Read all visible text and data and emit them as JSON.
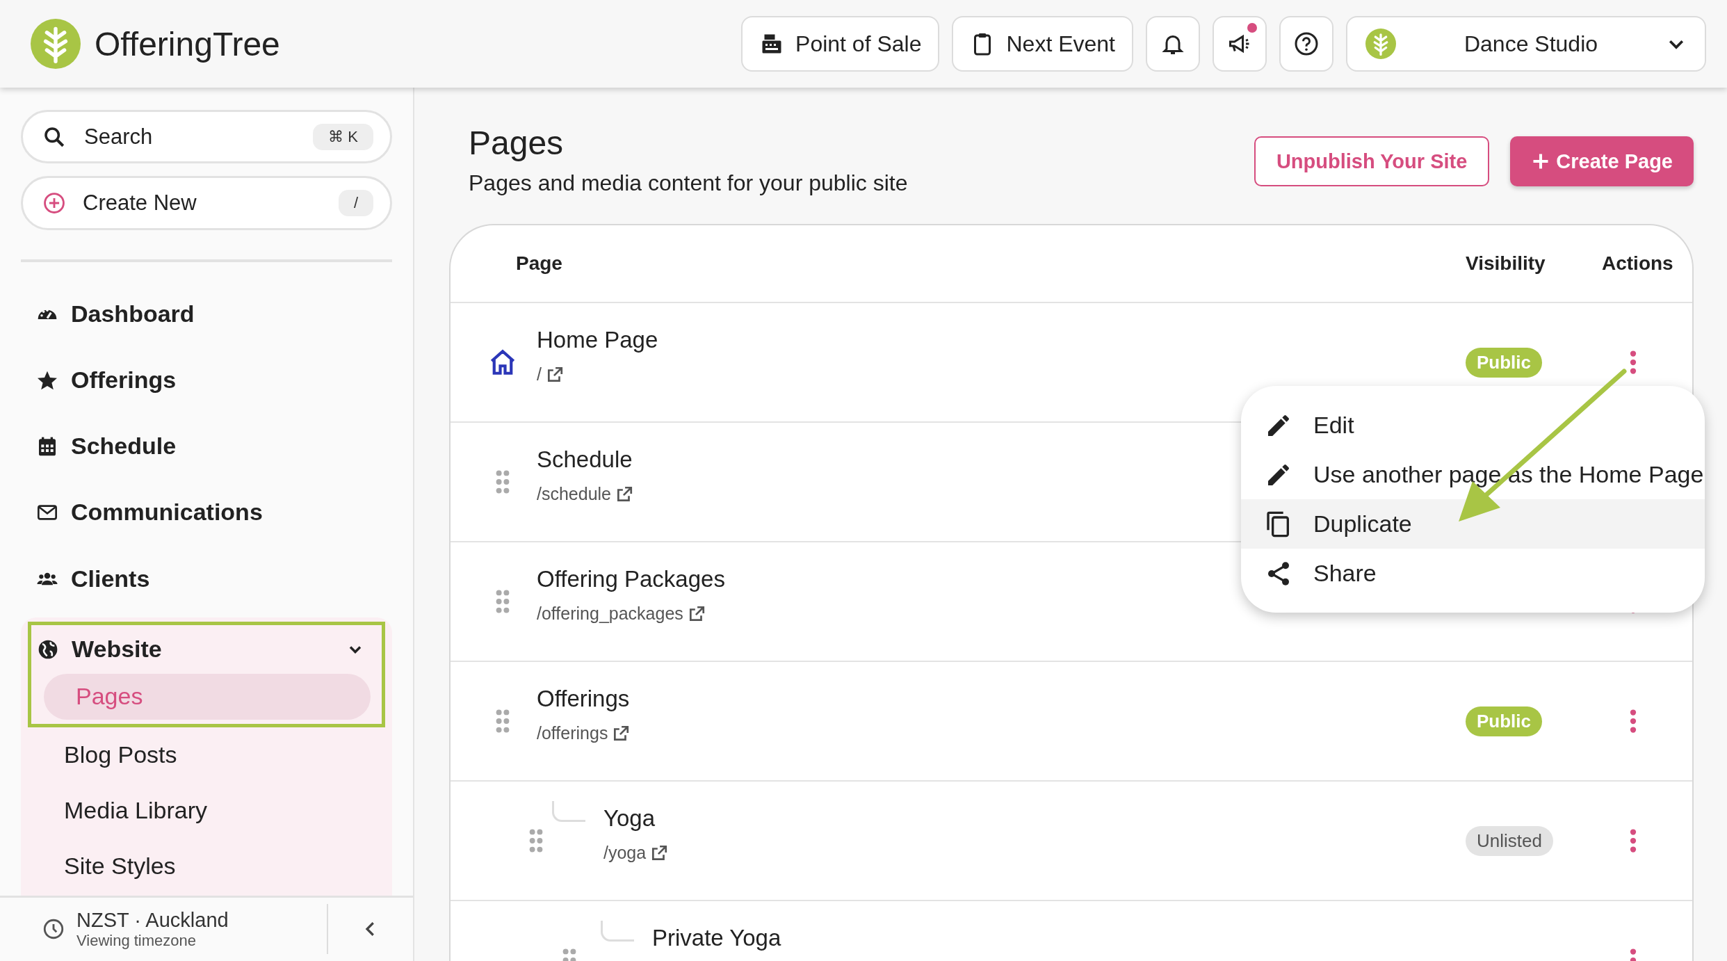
{
  "header": {
    "logo": "OfferingTree",
    "buttons": [
      {
        "kind": "register",
        "label": "Point of Sale"
      },
      {
        "kind": "clipboard",
        "label": "Next Event"
      },
      {
        "kind": "bell"
      },
      {
        "kind": "megaphone",
        "badge": true
      },
      {
        "kind": "help"
      }
    ],
    "studio": {
      "label": "Dance Studio"
    }
  },
  "sidebar": {
    "search": {
      "placeholder": "Search",
      "shortcut": "⌘ K"
    },
    "create": {
      "label": "Create New",
      "shortcut": "/"
    },
    "items": [
      {
        "kind": "dashboard",
        "label": "Dashboard"
      },
      {
        "kind": "star",
        "label": "Offerings"
      },
      {
        "kind": "calendar",
        "label": "Schedule"
      },
      {
        "kind": "mail",
        "label": "Communications"
      },
      {
        "kind": "users",
        "label": "Clients"
      },
      {
        "kind": "globe",
        "label": "Website",
        "expanded": true,
        "children": [
          {
            "label": "Pages",
            "selected": true
          },
          {
            "label": "Blog Posts",
            "selected": false
          },
          {
            "label": "Media Library",
            "selected": false
          },
          {
            "label": "Site Styles",
            "selected": false
          }
        ]
      }
    ],
    "footer": {
      "timezone": "NZST · Auckland",
      "caption": "Viewing timezone"
    }
  },
  "main": {
    "title": "Pages",
    "subtitle": "Pages and media content for your public site",
    "buttons": [
      {
        "kind": "outline",
        "label": "Unpublish Your Site"
      },
      {
        "kind": "primary",
        "label": "Create Page"
      }
    ]
  },
  "table": {
    "columns": [
      "Page",
      "Visibility",
      "Actions"
    ],
    "rows": [
      {
        "kind": "home",
        "name": "Home Page",
        "path": "/",
        "actions": true,
        "visibility": {
          "kind": "public",
          "label": "Public"
        }
      },
      {
        "kind": "page",
        "name": "Schedule",
        "path": "/schedule"
      },
      {
        "kind": "page",
        "name": "Offering Packages",
        "path": "/offering_packages",
        "actions": true
      },
      {
        "kind": "page",
        "name": "Offerings",
        "path": "/offerings",
        "actions": true,
        "visibility": {
          "kind": "public",
          "label": "Public"
        },
        "children": [
          {
            "kind": "page",
            "name": "Yoga",
            "path": "/yoga",
            "actions": true,
            "visibility": {
              "kind": "unlisted",
              "label": "Unlisted"
            },
            "children": [
              {
                "kind": "page",
                "name": "Private Yoga",
                "actions": true
              }
            ]
          }
        ]
      }
    ]
  },
  "menu": {
    "items": [
      {
        "kind": "pencil",
        "label": "Edit",
        "highlighted": false
      },
      {
        "kind": "pencil",
        "label": "Use another page as the Home Page",
        "highlighted": false
      },
      {
        "kind": "copy",
        "label": "Duplicate",
        "highlighted": true
      },
      {
        "kind": "share",
        "label": "Share",
        "highlighted": false
      }
    ]
  },
  "annotations": {
    "highlight_box": true,
    "arrow": true
  }
}
